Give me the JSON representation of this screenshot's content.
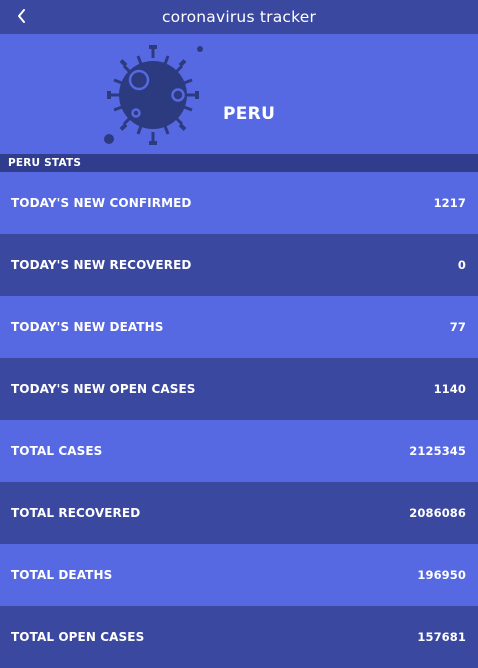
{
  "appbar": {
    "title": "coronavirus tracker",
    "back_icon": "chevron-left-icon"
  },
  "hero": {
    "country": "PERU",
    "icon": "virus-icon"
  },
  "section": {
    "title": "PERU STATS"
  },
  "stats": [
    {
      "label": "TODAY'S NEW CONFIRMED",
      "value": "1217"
    },
    {
      "label": "TODAY'S NEW RECOVERED",
      "value": "0"
    },
    {
      "label": "TODAY'S NEW DEATHS",
      "value": "77"
    },
    {
      "label": "TODAY'S NEW OPEN CASES",
      "value": "1140"
    },
    {
      "label": "TOTAL CASES",
      "value": "2125345"
    },
    {
      "label": "TOTAL RECOVERED",
      "value": "2086086"
    },
    {
      "label": "TOTAL DEATHS",
      "value": "196950"
    },
    {
      "label": "TOTAL OPEN CASES",
      "value": "157681"
    }
  ],
  "colors": {
    "light_row": "#5669e2",
    "dark_row": "#3a48a0",
    "virus": "#2c3a80"
  }
}
